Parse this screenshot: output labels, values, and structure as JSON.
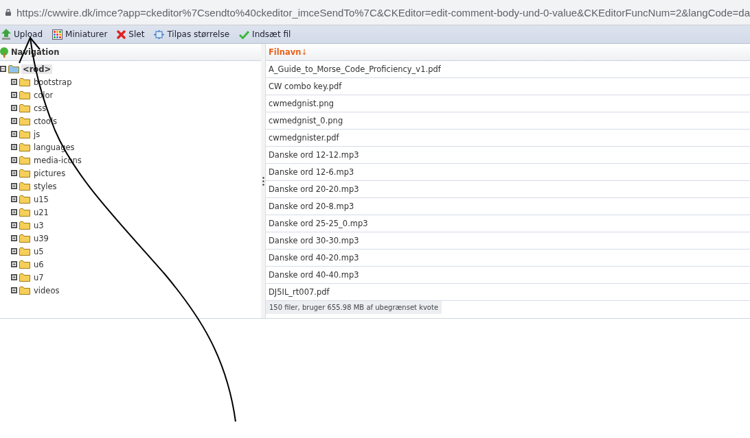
{
  "address_bar": {
    "url": "https://cwwire.dk/imce?app=ckeditor%7Csendto%40ckeditor_imceSendTo%7C&CKEditor=edit-comment-body-und-0-value&CKEditorFuncNum=2&langCode=da"
  },
  "toolbar": [
    {
      "kind": "upload",
      "label": "Upload"
    },
    {
      "kind": "thumbnails",
      "label": "Miniaturer"
    },
    {
      "kind": "delete",
      "label": "Slet"
    },
    {
      "kind": "resize",
      "label": "Tilpas størrelse"
    },
    {
      "kind": "insert",
      "label": "Indsæt fil"
    }
  ],
  "navigation": {
    "title": "Navigation",
    "tree": [
      {
        "label": "<rod>",
        "expanded": true,
        "selected": true,
        "children": [
          {
            "label": "bootstrap",
            "expanded": false,
            "selected": false
          },
          {
            "label": "color",
            "expanded": false,
            "selected": false
          },
          {
            "label": "css",
            "expanded": false,
            "selected": false
          },
          {
            "label": "ctools",
            "expanded": false,
            "selected": false
          },
          {
            "label": "js",
            "expanded": false,
            "selected": false
          },
          {
            "label": "languages",
            "expanded": false,
            "selected": false
          },
          {
            "label": "media-icons",
            "expanded": false,
            "selected": false
          },
          {
            "label": "pictures",
            "expanded": false,
            "selected": false
          },
          {
            "label": "styles",
            "expanded": false,
            "selected": false
          },
          {
            "label": "u15",
            "expanded": false,
            "selected": false
          },
          {
            "label": "u21",
            "expanded": false,
            "selected": false
          },
          {
            "label": "u3",
            "expanded": false,
            "selected": false
          },
          {
            "label": "u39",
            "expanded": false,
            "selected": false
          },
          {
            "label": "u5",
            "expanded": false,
            "selected": false
          },
          {
            "label": "u6",
            "expanded": false,
            "selected": false
          },
          {
            "label": "u7",
            "expanded": false,
            "selected": false
          },
          {
            "label": "videos",
            "expanded": false,
            "selected": false
          }
        ]
      }
    ]
  },
  "file_list": {
    "column": "Filnavn",
    "sort_indicator": "↓",
    "files": [
      "A_Guide_to_Morse_Code_Proficiency_v1.pdf",
      "CW combo key.pdf",
      "cwmedgnist.png",
      "cwmedgnist_0.png",
      "cwmedgnister.pdf",
      "Danske ord 12-12.mp3",
      "Danske ord 12-6.mp3",
      "Danske ord 20-20.mp3",
      "Danske ord 20-8.mp3",
      "Danske ord 25-25_0.mp3",
      "Danske ord 30-30.mp3",
      "Danske ord 40-20.mp3",
      "Danske ord 40-40.mp3",
      "DJ5IL_rt007.pdf"
    ],
    "status": "150 filer, bruger 655.98 MB af ubegrænset kvote"
  }
}
